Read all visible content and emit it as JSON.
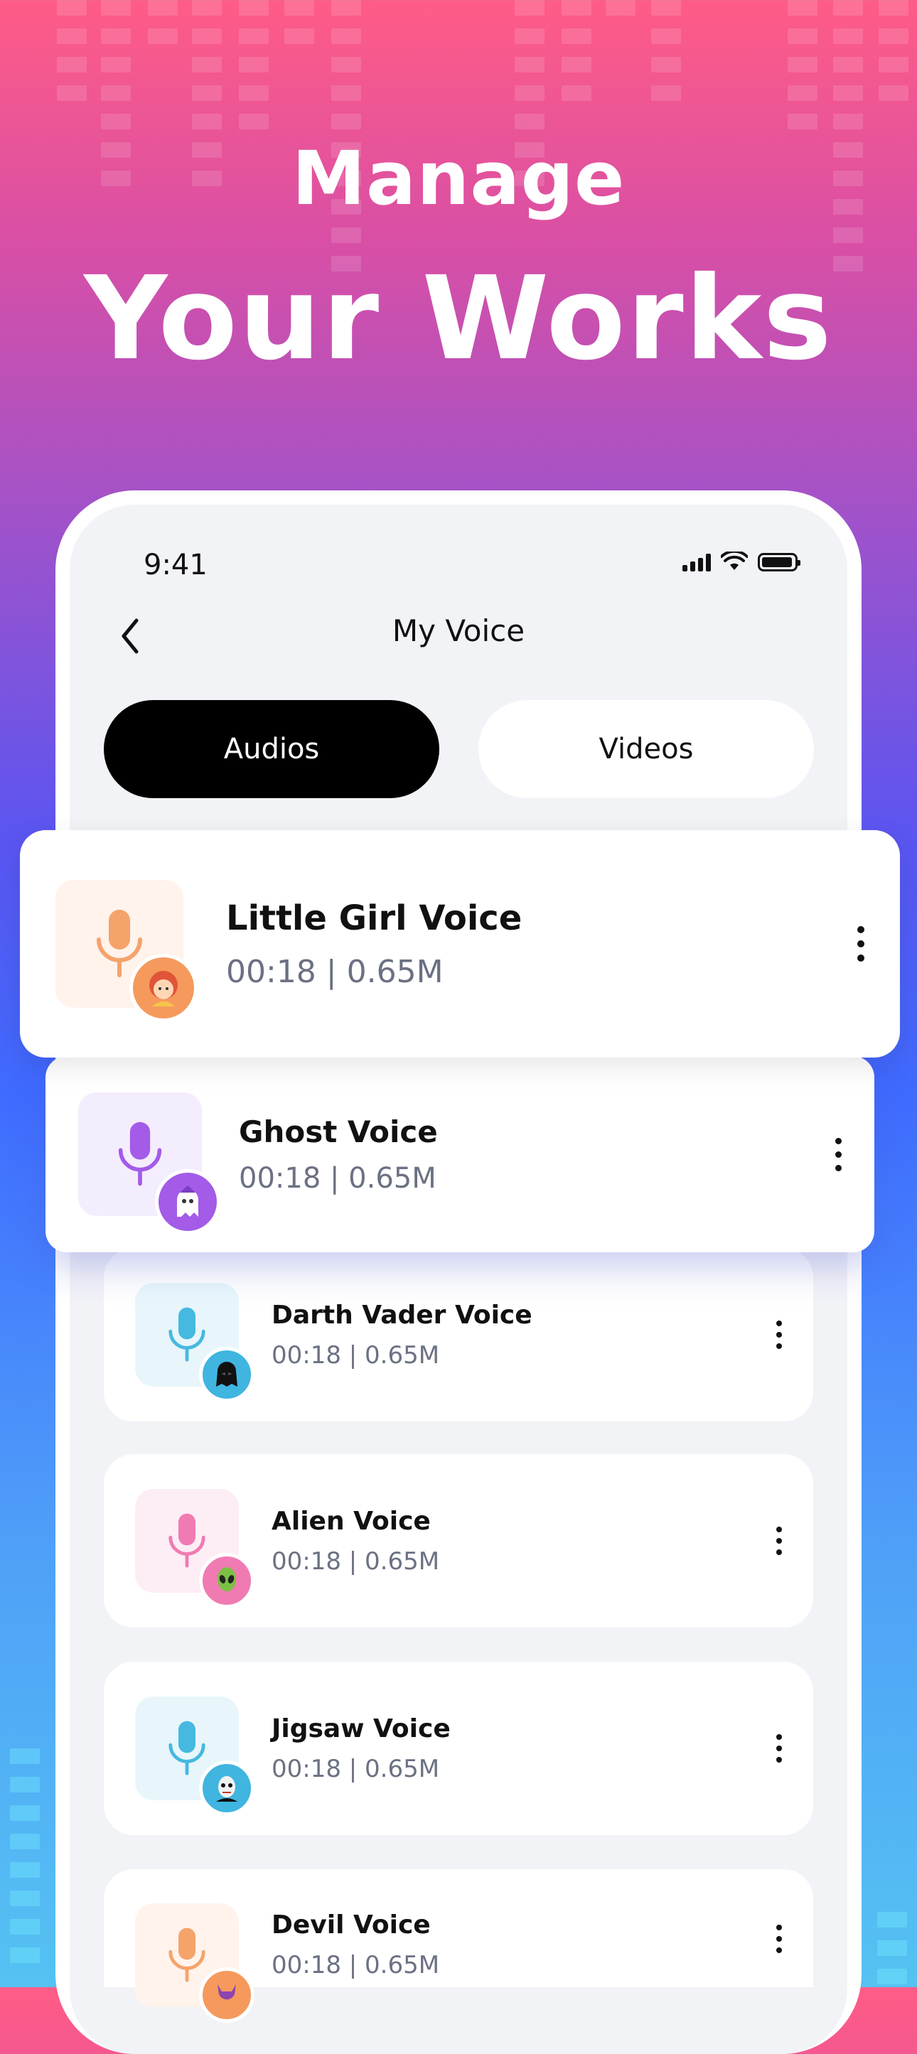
{
  "hero": {
    "line1": "Manage",
    "line2": "Your Works"
  },
  "status_bar": {
    "time": "9:41"
  },
  "nav": {
    "title": "My Voice"
  },
  "tabs": [
    {
      "label": "Audios",
      "active": true
    },
    {
      "label": "Videos",
      "active": false
    }
  ],
  "voices": [
    {
      "title": "Little Girl  Voice",
      "meta": "00:18 | 0.65M",
      "icon": "girl-avatar-icon",
      "accent": "#f5a36b",
      "tint": "#fff3ec",
      "avatar_bg": "#f59a5c"
    },
    {
      "title": "Ghost Voice",
      "meta": "00:18 | 0.65M",
      "icon": "ghost-avatar-icon",
      "accent": "#a35be8",
      "tint": "#f4edfd",
      "avatar_bg": "#a35be8"
    },
    {
      "title": "Darth Vader Voice",
      "meta": "00:18 | 0.65M",
      "icon": "darth-vader-avatar-icon",
      "accent": "#45b9e0",
      "tint": "#e8f6fb",
      "avatar_bg": "#3fb5e0"
    },
    {
      "title": "Alien Voice",
      "meta": "00:18 | 0.65M",
      "icon": "alien-avatar-icon",
      "accent": "#f07bb2",
      "tint": "#fdedf4",
      "avatar_bg": "#f07bb2"
    },
    {
      "title": "Jigsaw Voice",
      "meta": "00:18 | 0.65M",
      "icon": "jigsaw-avatar-icon",
      "accent": "#45b9e0",
      "tint": "#e8f6fb",
      "avatar_bg": "#3fb5e0"
    },
    {
      "title": "Devil Voice",
      "meta": "00:18 | 0.65M",
      "icon": "devil-avatar-icon",
      "accent": "#f5a36b",
      "tint": "#fff3ec",
      "avatar_bg": "#f59a5c"
    }
  ]
}
